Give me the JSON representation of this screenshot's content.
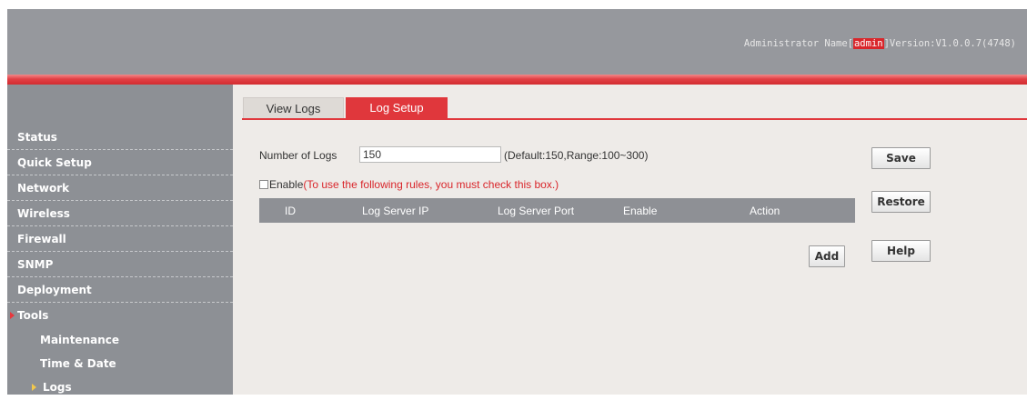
{
  "header": {
    "admin_prefix": "Administrator Name[",
    "admin_name": "admin",
    "version_text": "]Version:V1.0.0.7(4748)"
  },
  "sidebar": {
    "items": [
      {
        "label": "Status"
      },
      {
        "label": "Quick Setup"
      },
      {
        "label": "Network"
      },
      {
        "label": "Wireless"
      },
      {
        "label": "Firewall"
      },
      {
        "label": "SNMP"
      },
      {
        "label": "Deployment"
      },
      {
        "label": "Tools",
        "expanded": true
      },
      {
        "label": "Maintenance"
      },
      {
        "label": "Time & Date"
      },
      {
        "label": "Logs",
        "selected": true
      }
    ]
  },
  "tabs": [
    {
      "label": "View Logs",
      "active": false
    },
    {
      "label": "Log Setup",
      "active": true
    }
  ],
  "form": {
    "num_logs_label": "Number of Logs",
    "num_logs_value": "150",
    "num_logs_hint": "(Default:150,Range:100~300)",
    "enable_label": "Enable",
    "enable_note": "(To use the following rules, you must check this box.)",
    "enable_checked": false
  },
  "table": {
    "columns": [
      "ID",
      "Log Server IP",
      "Log Server Port",
      "Enable",
      "Action"
    ],
    "rows": []
  },
  "buttons": {
    "save": "Save",
    "restore": "Restore",
    "help": "Help",
    "add": "Add"
  },
  "colors": {
    "accent_red": "#e0373c",
    "header_gray": "#96989d",
    "sidebar_gray": "#8d9095",
    "content_bg": "#eeebe8"
  }
}
